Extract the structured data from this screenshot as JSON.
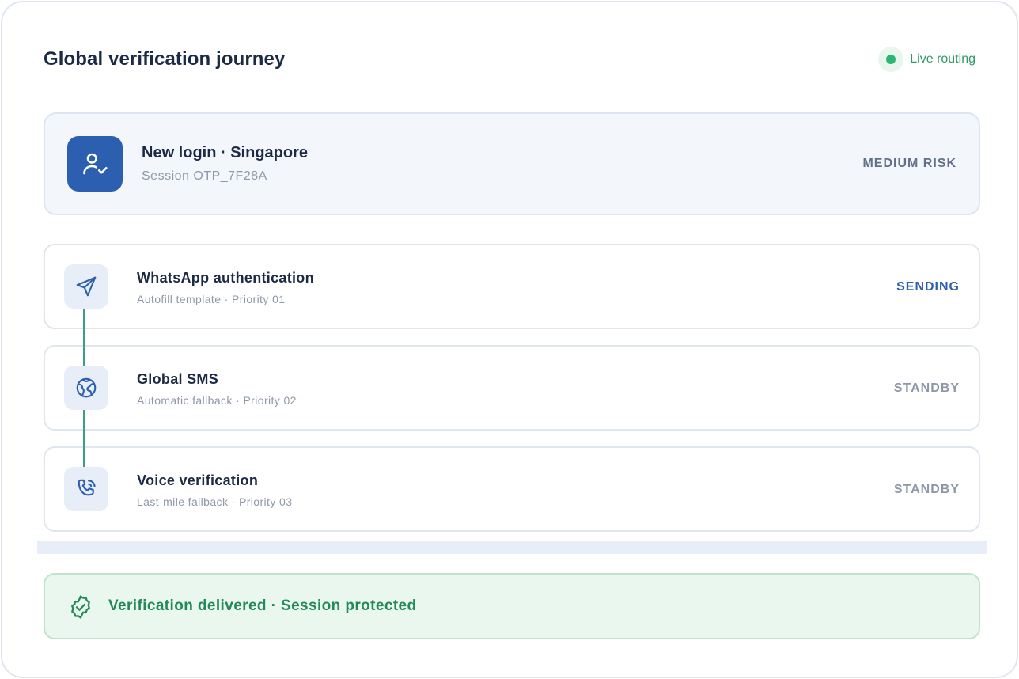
{
  "header": {
    "title": "Global verification journey",
    "live_label": "Live routing"
  },
  "login": {
    "title": "New login · Singapore",
    "session": "Session OTP_7F28A",
    "risk": "MEDIUM RISK",
    "icon": "user-check-icon"
  },
  "steps": [
    {
      "title": "WhatsApp authentication",
      "subtitle": "Autofill template · Priority 01",
      "status": "SENDING",
      "icon": "send-icon"
    },
    {
      "title": "Global SMS",
      "subtitle": "Automatic fallback · Priority 02",
      "status": "STANDBY",
      "icon": "globe-icon"
    },
    {
      "title": "Voice verification",
      "subtitle": "Last-mile fallback · Priority 03",
      "status": "STANDBY",
      "icon": "phone-call-icon"
    }
  ],
  "footer": {
    "message": "Verification delivered · Session protected",
    "icon": "badge-check-icon"
  },
  "colors": {
    "accent": "#2d5fb0",
    "live_green": "#2bb673",
    "success_text": "#238a57",
    "standby_text": "#8c97a8"
  }
}
